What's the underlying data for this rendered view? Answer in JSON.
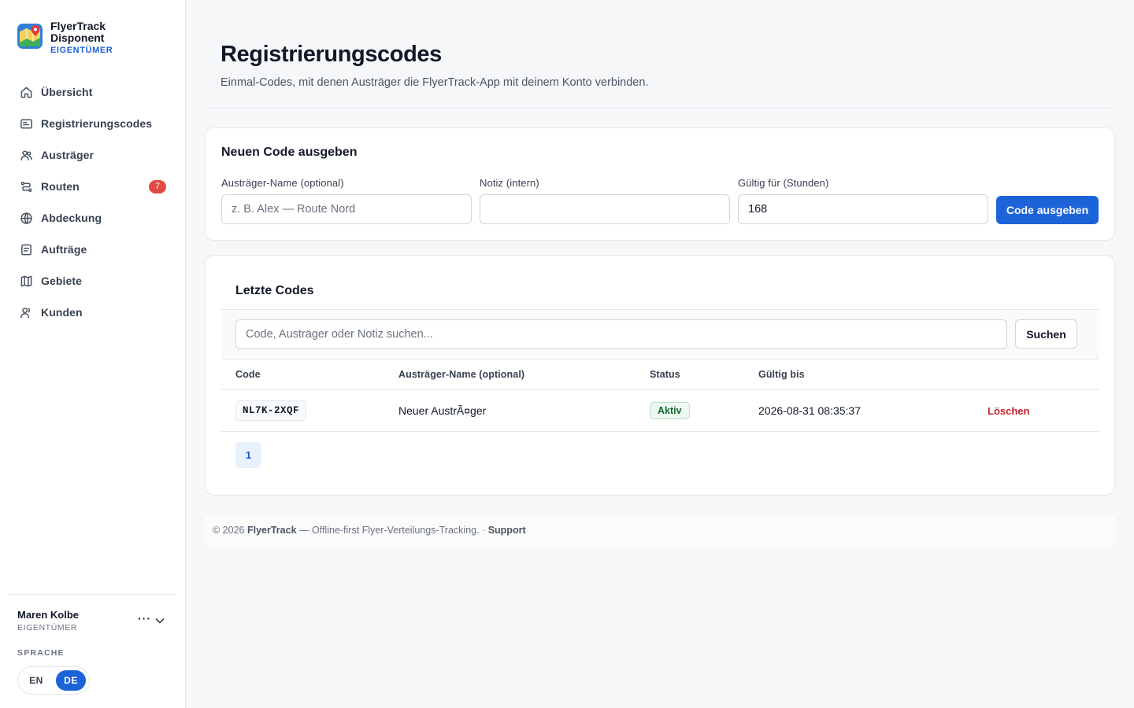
{
  "brand": {
    "name_line1": "FlyerTrack",
    "name_line2": "Disponent",
    "role": "EIGENTÜMER",
    "logo_icon": "map-pin-logo-icon"
  },
  "nav": {
    "items": [
      {
        "label": "Übersicht",
        "icon": "home-icon"
      },
      {
        "label": "Registrierungscodes",
        "icon": "id-card-icon"
      },
      {
        "label": "Austräger",
        "icon": "users-icon"
      },
      {
        "label": "Routen",
        "icon": "route-icon",
        "badge": "7"
      },
      {
        "label": "Abdeckung",
        "icon": "globe-icon"
      },
      {
        "label": "Aufträge",
        "icon": "document-icon"
      },
      {
        "label": "Gebiete",
        "icon": "map-icon"
      },
      {
        "label": "Kunden",
        "icon": "customers-icon"
      }
    ]
  },
  "user": {
    "name": "Maren Kolbe",
    "role": "EIGENTÜMER",
    "more": "···"
  },
  "language": {
    "label": "SPRACHE",
    "en": "EN",
    "de": "DE",
    "active": "DE"
  },
  "page": {
    "title": "Registrierungscodes",
    "subtitle": "Einmal-Codes, mit denen Austräger die FlyerTrack-App mit deinem Konto verbinden."
  },
  "new_code": {
    "title": "Neuen Code ausgeben",
    "name_label": "Austräger-Name (optional)",
    "name_placeholder": "z. B. Alex — Route Nord",
    "name_value": "",
    "note_label": "Notiz (intern)",
    "note_value": "",
    "hours_label": "Gültig für (Stunden)",
    "hours_value": "168",
    "submit_label": "Code ausgeben"
  },
  "recent_codes": {
    "title": "Letzte Codes",
    "search_placeholder": "Code, Austräger oder Notiz suchen...",
    "search_button": "Suchen",
    "columns": [
      "Code",
      "Austräger-Name (optional)",
      "Status",
      "Gültig bis"
    ],
    "rows": [
      {
        "code": "NL7K-2XQF",
        "name": "Neuer AustrÃ¤ger",
        "status": "Aktiv",
        "valid_until": "2026-08-31 08:35:37",
        "action": "Löschen"
      }
    ],
    "pagination": {
      "current": "1"
    }
  },
  "footer": {
    "copyright": "© 2026",
    "brand": "FlyerTrack",
    "tagline": "— Offline-first Flyer-Verteilungs-Tracking.",
    "separator": "·",
    "support": "Support"
  },
  "colors": {
    "accent": "#1d63d8",
    "badge": "#e04b44",
    "danger": "#c0262d",
    "success": "#166534",
    "background": "#f6f7f9"
  }
}
